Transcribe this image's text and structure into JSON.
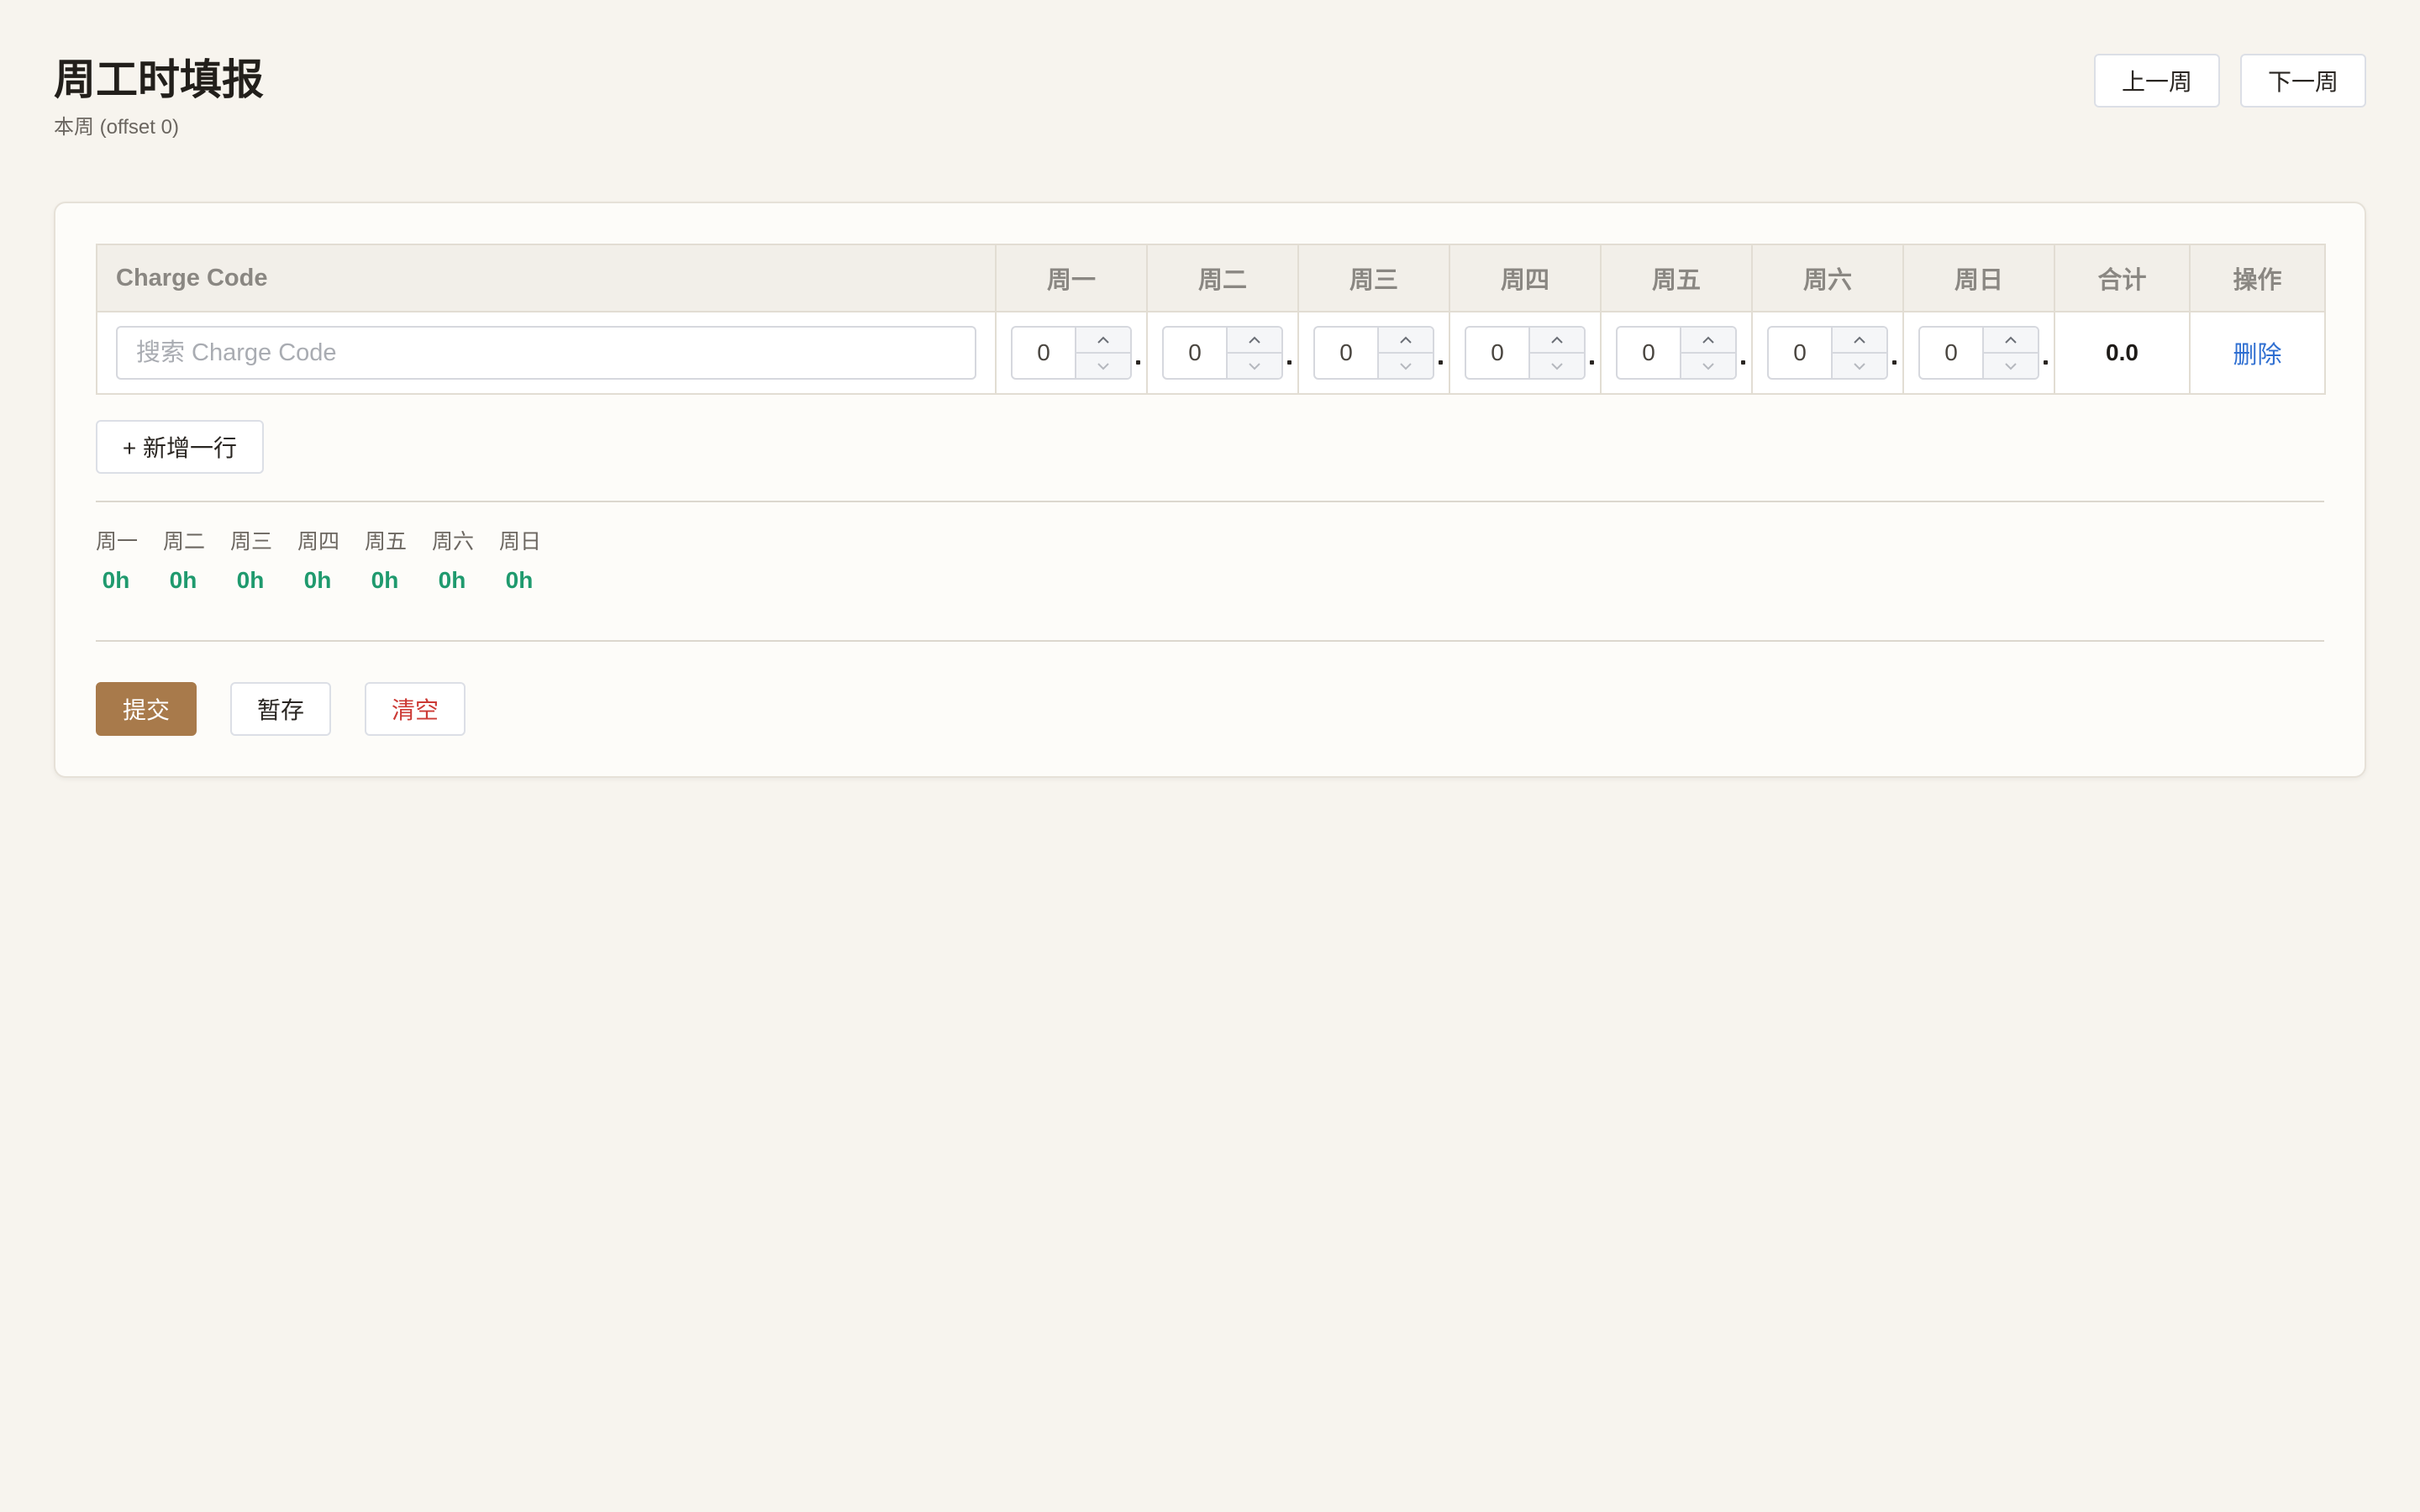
{
  "header": {
    "title": "周工时填报",
    "subtitle": "本周 (offset 0)",
    "prev_week_label": "上一周",
    "next_week_label": "下一周"
  },
  "table": {
    "columns": {
      "charge_code": "Charge Code",
      "mon": "周一",
      "tue": "周二",
      "wed": "周三",
      "thu": "周四",
      "fri": "周五",
      "sat": "周六",
      "sun": "周日",
      "total": "合计",
      "action": "操作"
    },
    "rows": [
      {
        "charge_code_value": "",
        "charge_code_placeholder": "搜索 Charge Code",
        "hours": [
          "0",
          "0",
          "0",
          "0",
          "0",
          "0",
          "0"
        ],
        "total": "0.0",
        "delete_label": "删除"
      }
    ]
  },
  "add_row_label": "+ 新增一行",
  "summary": [
    {
      "day": "周一",
      "hours": "0h"
    },
    {
      "day": "周二",
      "hours": "0h"
    },
    {
      "day": "周三",
      "hours": "0h"
    },
    {
      "day": "周四",
      "hours": "0h"
    },
    {
      "day": "周五",
      "hours": "0h"
    },
    {
      "day": "周六",
      "hours": "0h"
    },
    {
      "day": "周日",
      "hours": "0h"
    }
  ],
  "actions": {
    "submit_label": "提交",
    "draft_label": "暂存",
    "clear_label": "清空"
  },
  "colors": {
    "background": "#f7f4ee",
    "primary": "#a87a4b",
    "hours_green": "#1f9a6e",
    "danger": "#cc3a35",
    "link": "#2f6fd1"
  },
  "icons": {
    "stepper_up": "chevron-up-icon",
    "stepper_down": "chevron-down-icon"
  }
}
